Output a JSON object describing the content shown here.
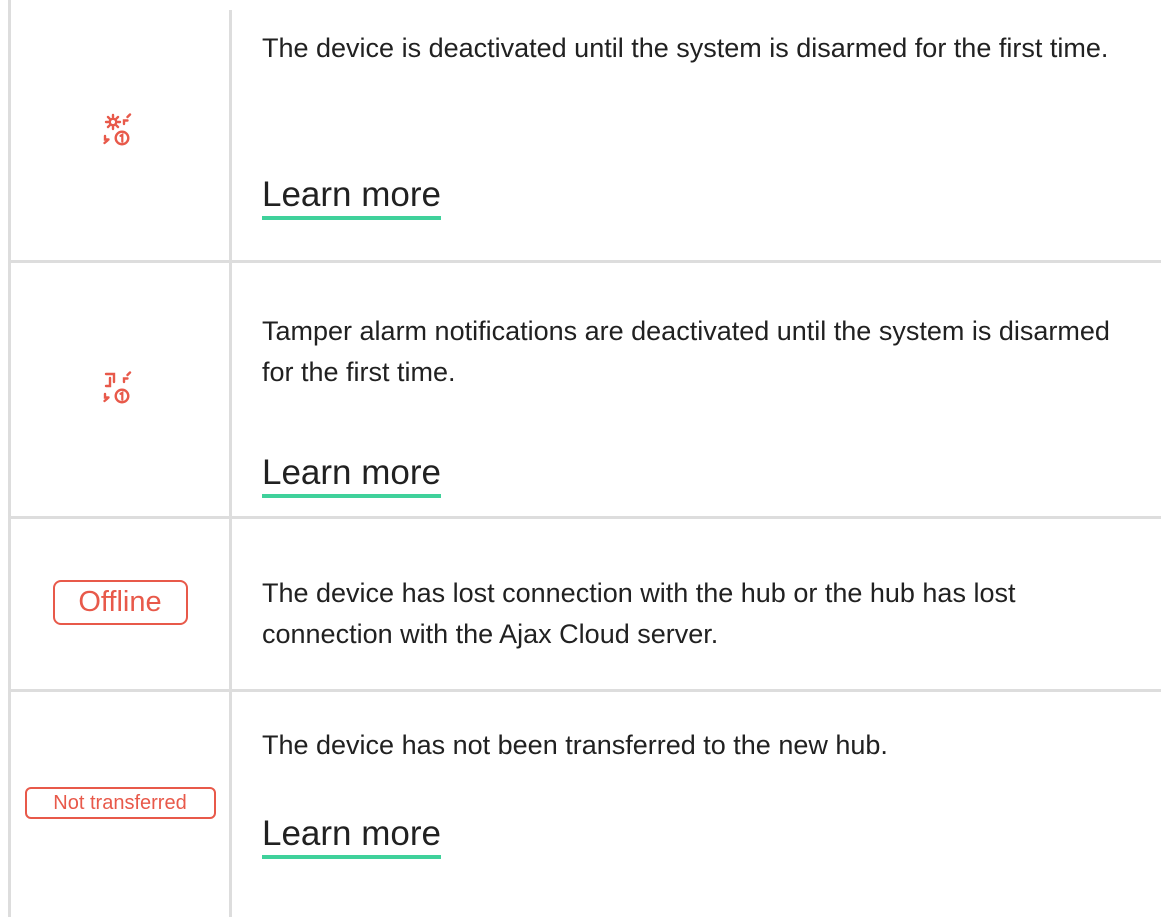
{
  "rows": [
    {
      "icon": "gear-counter-icon",
      "description": "The device is deactivated until the system is disarmed for the first time.",
      "link": "Learn more"
    },
    {
      "icon": "tamper-counter-icon",
      "description": "Tamper alarm notifications are deactivated until the system is disarmed for the first time.",
      "link": "Learn more"
    },
    {
      "badge": "Offline",
      "description": "The device has lost connection with the hub or the hub has lost connection with the Ajax Cloud server."
    },
    {
      "badge": "Not transferred",
      "description": "The device has not been transferred to the new hub.",
      "link": "Learn more"
    }
  ],
  "colors": {
    "accent_red": "#e8594a",
    "link_underline": "#3fd19b",
    "border": "#dddddd",
    "text": "#212121"
  }
}
